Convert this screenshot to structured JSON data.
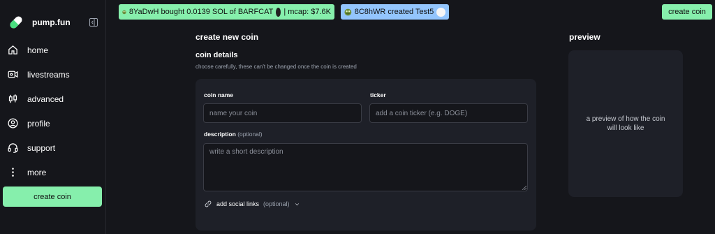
{
  "brand": {
    "name": "pump.fun"
  },
  "sidebar": {
    "items": [
      {
        "label": "home",
        "icon": "home-icon"
      },
      {
        "label": "livestreams",
        "icon": "video-icon"
      },
      {
        "label": "advanced",
        "icon": "candlestick-icon"
      },
      {
        "label": "profile",
        "icon": "user-circle-icon"
      },
      {
        "label": "support",
        "icon": "headset-icon"
      },
      {
        "label": "more",
        "icon": "more-vertical-icon"
      }
    ],
    "create_label": "create coin"
  },
  "ticker": {
    "buy": {
      "text": "8YaDwH bought 0.0139 SOL of BARFCAT",
      "mcap": "| mcap: $7.6K"
    },
    "create": {
      "text": "8C8hWR created Test5"
    }
  },
  "header": {
    "create_label": "create coin"
  },
  "form": {
    "page_title": "create new coin",
    "section_title": "coin details",
    "section_subtitle": "choose carefully, these can't be changed once the coin is created",
    "coin_name_label": "coin name",
    "coin_name_placeholder": "name your coin",
    "coin_name_value": "",
    "ticker_label": "ticker",
    "ticker_placeholder": "add a coin ticker (e.g. DOGE)",
    "ticker_value": "",
    "description_label": "description",
    "description_optional": "(optional)",
    "description_placeholder": "write a short description",
    "description_value": "",
    "social_label": "add social links",
    "social_optional": "(optional)"
  },
  "preview": {
    "title": "preview",
    "text": "a preview of how the coin will look like"
  },
  "colors": {
    "accent_green": "#86efac",
    "accent_blue": "#93c5fd",
    "background": "#15161b",
    "card": "#1e2028"
  }
}
